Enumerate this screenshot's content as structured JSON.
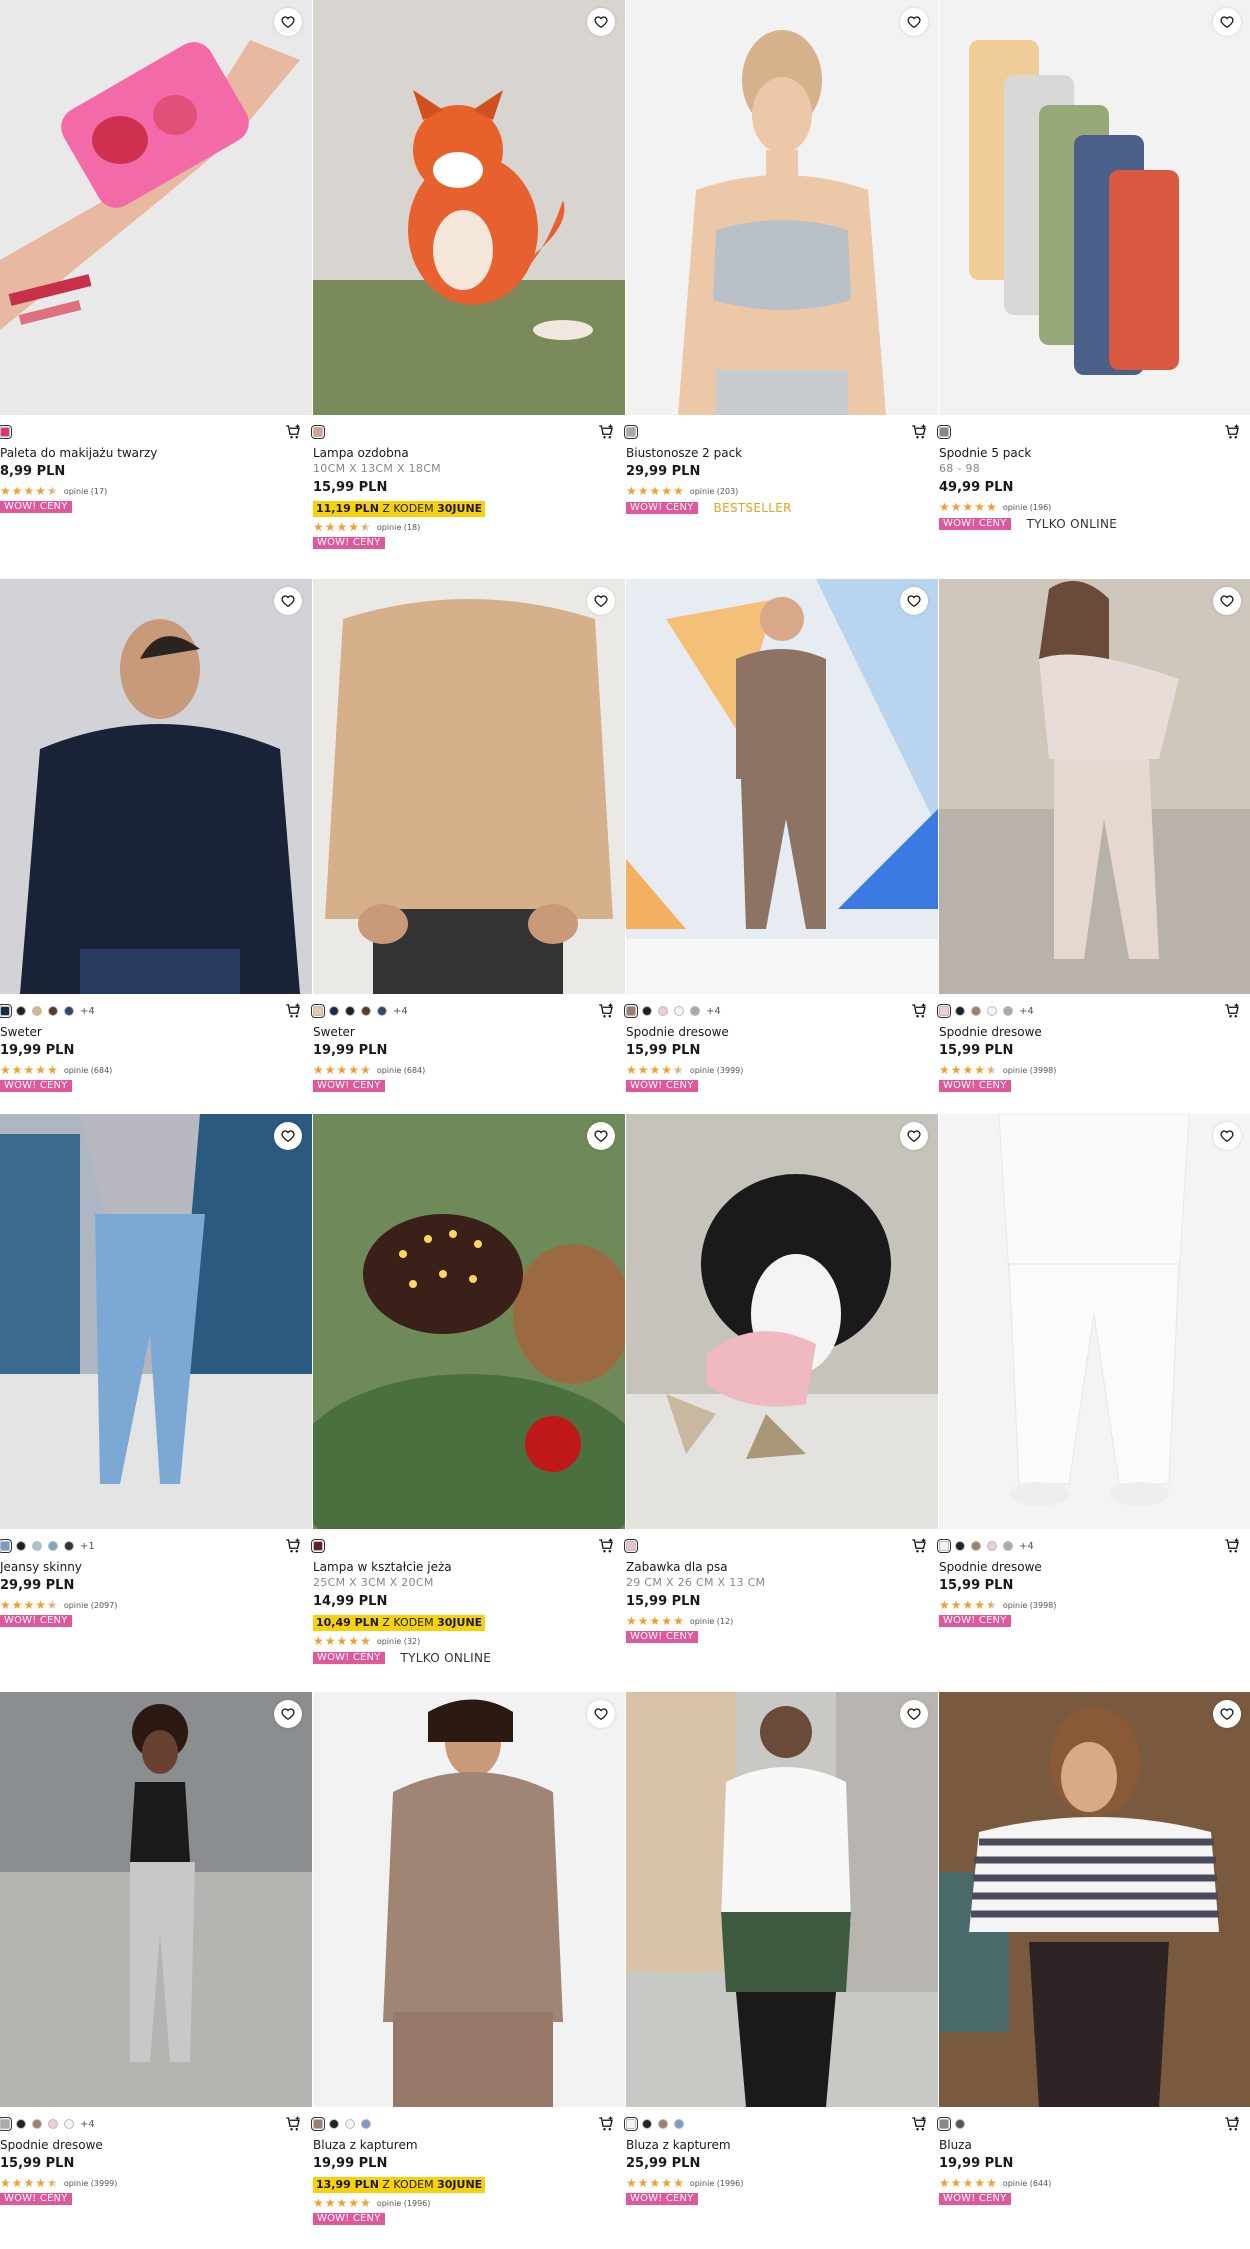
{
  "labels": {
    "wow": "WOW! CENY",
    "price_suffix": " PLN",
    "code_prefix": " Z KODEM ",
    "opinions_prefix": "opinie "
  },
  "icons": {
    "wishlist": "heart-icon",
    "cart": "add-to-cart-icon"
  },
  "products": [
    {
      "name": "Paleta do makijażu twarzy",
      "size": "",
      "price": "8,99 PLN",
      "promo": null,
      "stars": 4.5,
      "opinions": "(17)",
      "tags": [],
      "swatches": [
        "#e0346a"
      ],
      "more": "",
      "img": "makeup"
    },
    {
      "name": "Lampa ozdobna",
      "size": "10CM X 13CM X 18CM",
      "price": "15,99 PLN",
      "promo": {
        "price": "11,19 PLN",
        "code": "30JUNE"
      },
      "stars": 4.5,
      "opinions": "(18)",
      "tags": [],
      "swatches": [
        "#d8a090"
      ],
      "more": "",
      "img": "fox"
    },
    {
      "name": "Biustonosze 2 pack",
      "size": "",
      "price": "29,99 PLN",
      "promo": null,
      "stars": 5,
      "opinions": "(203)",
      "tags": [
        "BESTSELLER"
      ],
      "swatches": [
        "#aaaaaa"
      ],
      "more": "",
      "img": "bra"
    },
    {
      "name": "Spodnie 5 pack",
      "size": "68 - 98",
      "price": "49,99 PLN",
      "promo": null,
      "stars": 5,
      "opinions": "(196)",
      "tags": [
        "TYLKO ONLINE"
      ],
      "swatches": [
        "#888888"
      ],
      "more": "",
      "img": "pants5"
    },
    {
      "name": "Sweter",
      "size": "",
      "price": "19,99 PLN",
      "promo": null,
      "stars": 5,
      "opinions": "(684)",
      "tags": [],
      "swatches": [
        "#1b2a4a",
        "#222222",
        "#d8b48a",
        "#5a3a2a",
        "#2e4a70"
      ],
      "more": "+4",
      "img": "sweater_navy"
    },
    {
      "name": "Sweter",
      "size": "",
      "price": "19,99 PLN",
      "promo": null,
      "stars": 5,
      "opinions": "(684)",
      "tags": [],
      "swatches": [
        "#e8c9a8",
        "#1b2a4a",
        "#222222",
        "#5a3a2a",
        "#2e4a70"
      ],
      "more": "+4",
      "img": "sweater_beige"
    },
    {
      "name": "Spodnie dresowe",
      "size": "",
      "price": "15,99 PLN",
      "promo": null,
      "stars": 4.5,
      "opinions": "(3999)",
      "tags": [],
      "swatches": [
        "#9c7f6e",
        "#222222",
        "#e8d0d0",
        "#f4f4f4",
        "#aaaaaa"
      ],
      "more": "+4",
      "img": "track_brown"
    },
    {
      "name": "Spodnie dresowe",
      "size": "",
      "price": "15,99 PLN",
      "promo": null,
      "stars": 4.5,
      "opinions": "(3998)",
      "tags": [],
      "swatches": [
        "#e8d0d0",
        "#222222",
        "#9c7f6e",
        "#f4f4f4",
        "#aaaaaa"
      ],
      "more": "+4",
      "img": "track_pink"
    },
    {
      "name": "Jeansy skinny",
      "size": "",
      "price": "29,99 PLN",
      "promo": null,
      "stars": 4.5,
      "opinions": "(2097)",
      "tags": [],
      "swatches": [
        "#7a9cc8",
        "#222222",
        "#a8c0d0",
        "#7ea6c0",
        "#333333"
      ],
      "more": "+1",
      "img": "jeans"
    },
    {
      "name": "Lampa w kształcie jeża",
      "size": "25CM X 3CM X 20CM",
      "price": "14,99 PLN",
      "promo": {
        "price": "10,49 PLN",
        "code": "30JUNE"
      },
      "stars": 5,
      "opinions": "(32)",
      "tags": [
        "TYLKO ONLINE"
      ],
      "swatches": [
        "#6a2020"
      ],
      "more": "",
      "img": "hedgehog"
    },
    {
      "name": "Zabawka dla psa",
      "size": "29 CM X 26 CM X 13 CM",
      "price": "15,99 PLN",
      "promo": null,
      "stars": 5,
      "opinions": "(12)",
      "tags": [],
      "swatches": [
        "#f0c0c8"
      ],
      "more": "",
      "img": "dog"
    },
    {
      "name": "Spodnie dresowe",
      "size": "",
      "price": "15,99 PLN",
      "promo": null,
      "stars": 4.5,
      "opinions": "(3998)",
      "tags": [],
      "swatches": [
        "#f4f4f4",
        "#222222",
        "#9c7f6e",
        "#e8d0d0",
        "#aaaaaa"
      ],
      "more": "+4",
      "img": "track_white"
    },
    {
      "name": "Spodnie dresowe",
      "size": "",
      "price": "15,99 PLN",
      "promo": null,
      "stars": 4.5,
      "opinions": "(3999)",
      "tags": [],
      "swatches": [
        "#aaaaaa",
        "#222222",
        "#9c7f6e",
        "#e8d0d0",
        "#f4f4f4"
      ],
      "more": "+4",
      "img": "track_grey"
    },
    {
      "name": "Bluza z kapturem",
      "size": "",
      "price": "19,99 PLN",
      "promo": {
        "price": "13,99 PLN",
        "code": "30JUNE"
      },
      "stars": 5,
      "opinions": "(1996)",
      "tags": [],
      "swatches": [
        "#9c7f6e",
        "#222222",
        "#f4f4f4",
        "#7a9cc8"
      ],
      "more": "",
      "img": "hoodie_brown"
    },
    {
      "name": "Bluza z kapturem",
      "size": "",
      "price": "25,99 PLN",
      "promo": null,
      "stars": 5,
      "opinions": "(1996)",
      "tags": [],
      "swatches": [
        "#f4f4f4",
        "#222222",
        "#9c7f6e",
        "#7a9cc8"
      ],
      "more": "",
      "img": "hoodie_white"
    },
    {
      "name": "Bluza",
      "size": "",
      "price": "19,99 PLN",
      "promo": null,
      "stars": 5,
      "opinions": "(644)",
      "tags": [],
      "swatches": [
        "#888888",
        "#555555"
      ],
      "more": "",
      "img": "stripes"
    }
  ]
}
